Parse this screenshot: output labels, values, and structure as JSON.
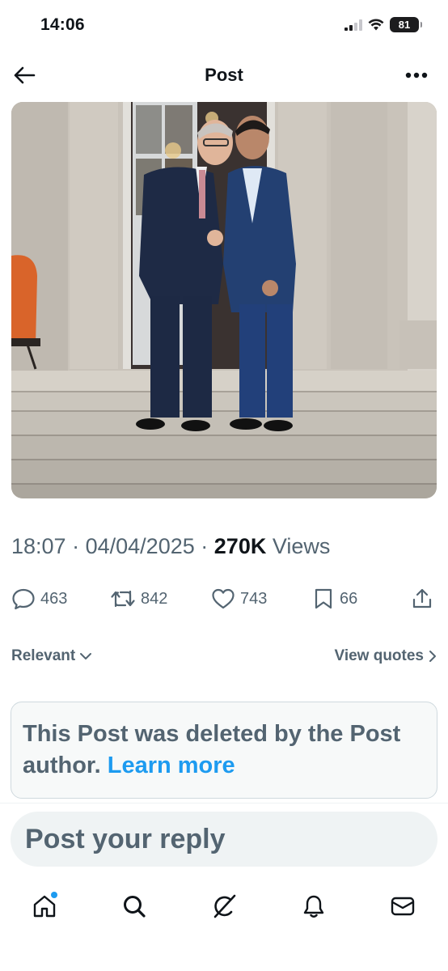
{
  "status_bar": {
    "time": "14:06",
    "battery_level": "81",
    "icons": [
      "cellular-signal-icon",
      "wifi-icon",
      "battery-icon"
    ]
  },
  "header": {
    "title": "Post",
    "back_icon": "arrow-left-icon",
    "more_icon": "more-horizontal-icon"
  },
  "post": {
    "media": {
      "type": "photo",
      "icon": "photo"
    },
    "time": "18:07",
    "date": "04/04/2025",
    "views_count": "270K",
    "views_label": "Views",
    "separator": "·"
  },
  "actions": {
    "replies": "463",
    "reposts": "842",
    "likes": "743",
    "bookmarks": "66",
    "icons": [
      "reply-icon",
      "repost-icon",
      "like-icon",
      "bookmark-icon",
      "share-icon"
    ]
  },
  "sort": {
    "relevant_label": "Relevant",
    "view_quotes_label": "View quotes"
  },
  "deleted_notice": {
    "text": "This Post was deleted by the Post author.",
    "link": "Learn more"
  },
  "reply": {
    "placeholder": "Post your reply"
  },
  "bottom_nav": {
    "items": [
      "home-icon",
      "search-icon",
      "grok-icon",
      "notifications-icon",
      "messages-icon"
    ],
    "home_has_badge": true
  },
  "colors": {
    "primary_text": "#0f1419",
    "secondary_text": "#536471",
    "accent": "#1d9bf0",
    "card_background": "#f7f9f9",
    "reply_background": "#eff3f4"
  }
}
